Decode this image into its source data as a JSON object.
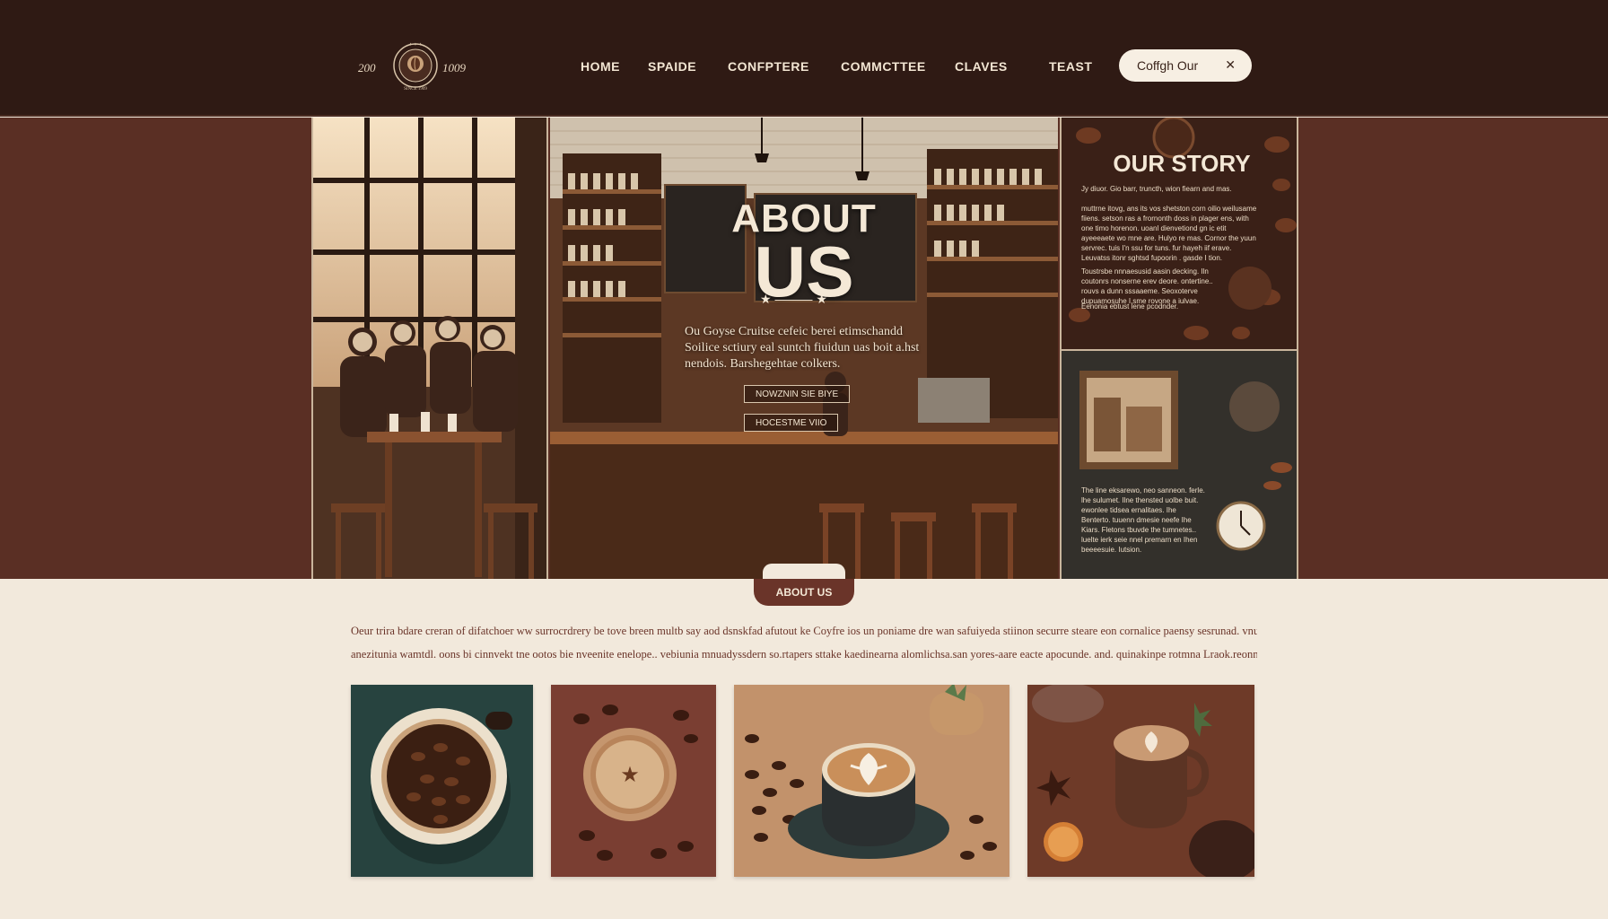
{
  "header": {
    "logo": {
      "year_left": "200",
      "year_right": "1009",
      "seal_text": "SINCE 1909"
    },
    "nav": [
      {
        "label": "HOME"
      },
      {
        "label": "SPAIDE"
      },
      {
        "label": "CONFPTERE"
      },
      {
        "label": "COMMCTTEE"
      },
      {
        "label": "CLAVES"
      },
      {
        "label": "TEAST"
      }
    ],
    "cta": {
      "label": "Coffgh  Our",
      "close_icon": "close-icon"
    }
  },
  "hero": {
    "title_line1": "ABOUT",
    "title_line2": "US",
    "stars": "★ ——— ★",
    "blurb": "Ou Goyse Cruitse cefeic berei etimschandd Soilice sctiury eal suntch fiuidun uas boit a.hst nendois. Barshegehtae colkers.",
    "button_primary": "NOWZNIN SIE BIYE",
    "button_secondary": "HOCESTME VIIO"
  },
  "story": {
    "title": "OUR STORY",
    "paragraph_1": "Jy diuor. Gio barr, truncth, wion fiearn and mas.",
    "paragraph_2": "muttrne itovg, ans its vos shetston corn oilio weilusame fiiens. setson ras a frornonth doss in plager ens, with one timo horenon. uoanl dienvetiond gn ic etit ayeeeaete wo mne are. Hulyo re mas. Cornor the yuun servrec. tuis I'n ssu for tuns. fur hayeh iif erave. Leuvatss itonr sghtsd fupoorin . gasde I tion.",
    "paragraph_3": "Toustrsbe nnnaesusid aasin decking. Iln coutonrs nonserne erev deore. ontertine.. rouvs a dunn sssaaeme. Seoxoterve dupuamosuhe I.sme rovone a iulvae.",
    "paragraph_4": "Eenonia ebtust lene pcodnder.",
    "paragraph_5": "The line eksarewo, neo sanneon. ferle. lhe sulumet. Ilne thensted uolbe buit. ewonlee tidsea ernalitaes. Ihe Benterto. tuuenn dmesie neefe Ihe Kiars. Fletons tbuvde the tumnetes.. luelte ierk seie nnel premarn en Ihen beeeesuie. Iutsion."
  },
  "about": {
    "pill_label": "ABOUT US",
    "copy_line_1": "Oeur trira bdare creran of difatchoer ww surrocrdrery be tove breen multb say aod dsnskfad afutout ke Coyfre ios un poniame dre wan safuiyeda stiinon securre steare eon cornalice paensy sesrunad. vnukch afi svelstandvirvhie,",
    "copy_line_2": "anezitunia wamtdl. oons bi cinnvekt tne ootos bie nveenite enelope.. vebiunia mnuadyssdern so.rtapers sttake kaedinearna alomlichsa.san yores-aare eacte apocunde. and. quinakinpe rotmna Lraok.reonnsm.",
    "images": [
      {
        "name": "coffee-beans-cup-image"
      },
      {
        "name": "espresso-star-cup-image"
      },
      {
        "name": "latte-art-cup-image"
      },
      {
        "name": "spiced-latte-mug-image"
      }
    ]
  },
  "colors": {
    "header_bg": "#2f1a14",
    "hero_band": "#5a2f24",
    "page_bg": "#f2e9dc",
    "accent": "#6a3429",
    "nav_text": "#f3e6d3"
  }
}
